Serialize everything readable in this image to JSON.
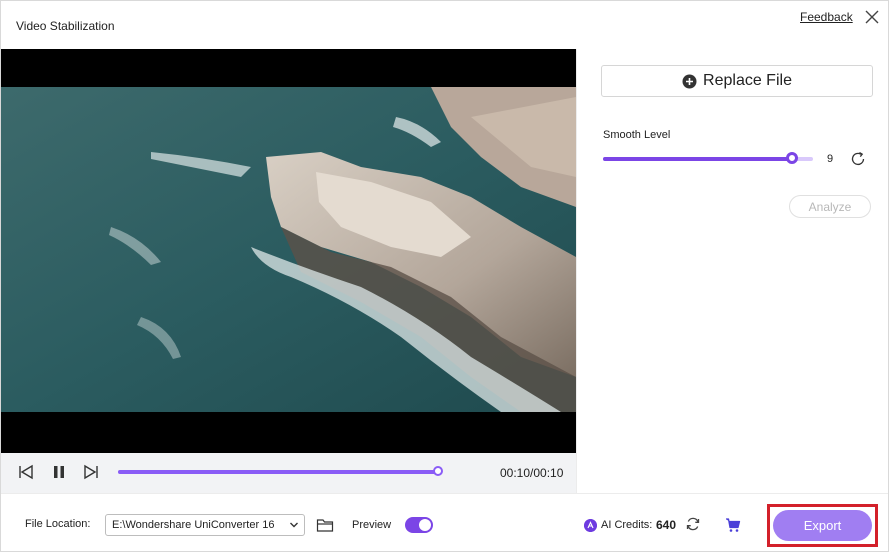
{
  "window": {
    "title": "Video Stabilization",
    "feedback_label": "Feedback"
  },
  "icons": {
    "close": "close-icon",
    "replace": "plus-circle-icon",
    "reset": "reset-icon",
    "prev": "skip-previous-icon",
    "pause": "pause-icon",
    "next": "skip-next-icon",
    "folder": "folder-icon",
    "credits": "ai-credits-icon",
    "refresh": "refresh-icon",
    "cart": "cart-icon",
    "chevron": "chevron-down-icon"
  },
  "playback": {
    "time": "00:10/00:10",
    "progress": 1.0
  },
  "panel": {
    "replace_label": "Replace File",
    "smooth_label": "Smooth Level",
    "smooth_value": "9",
    "smooth_fraction": 0.9,
    "analyze_label": "Analyze"
  },
  "footer": {
    "file_location_label": "File Location:",
    "file_location_value": "E:\\Wondershare UniConverter 16",
    "preview_label": "Preview",
    "preview_on": true,
    "credits_label": "AI Credits:",
    "credits_value": "640",
    "export_label": "Export"
  },
  "colors": {
    "accent": "#7b45e6",
    "export": "#a07ef2",
    "highlight": "#d3202a"
  }
}
